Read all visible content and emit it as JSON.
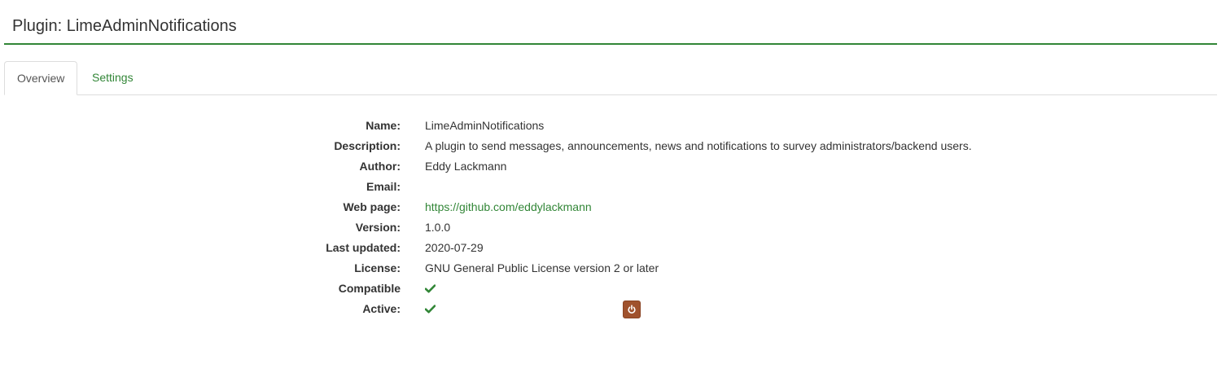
{
  "header": {
    "title": "Plugin: LimeAdminNotifications"
  },
  "tabs": [
    {
      "label": "Overview",
      "active": true
    },
    {
      "label": "Settings",
      "active": false
    }
  ],
  "details": {
    "name": {
      "label": "Name:",
      "value": "LimeAdminNotifications"
    },
    "description": {
      "label": "Description:",
      "value": "A plugin to send messages, announcements, news and notifications to survey administrators/backend users."
    },
    "author": {
      "label": "Author:",
      "value": "Eddy Lackmann"
    },
    "email": {
      "label": "Email:",
      "value": ""
    },
    "web_page": {
      "label": "Web page:",
      "value": "https://github.com/eddylackmann"
    },
    "version": {
      "label": "Version:",
      "value": "1.0.0"
    },
    "last_updated": {
      "label": "Last updated:",
      "value": "2020-07-29"
    },
    "license": {
      "label": "License:",
      "value": "GNU General Public License version 2 or later"
    },
    "compatible": {
      "label": "Compatible",
      "icon": "check-icon",
      "state": true
    },
    "active": {
      "label": "Active:",
      "icon": "check-icon",
      "state": true,
      "toggle_icon": "power-icon"
    }
  },
  "colors": {
    "accent": "#328637",
    "toggle_button": "#a0522d"
  }
}
